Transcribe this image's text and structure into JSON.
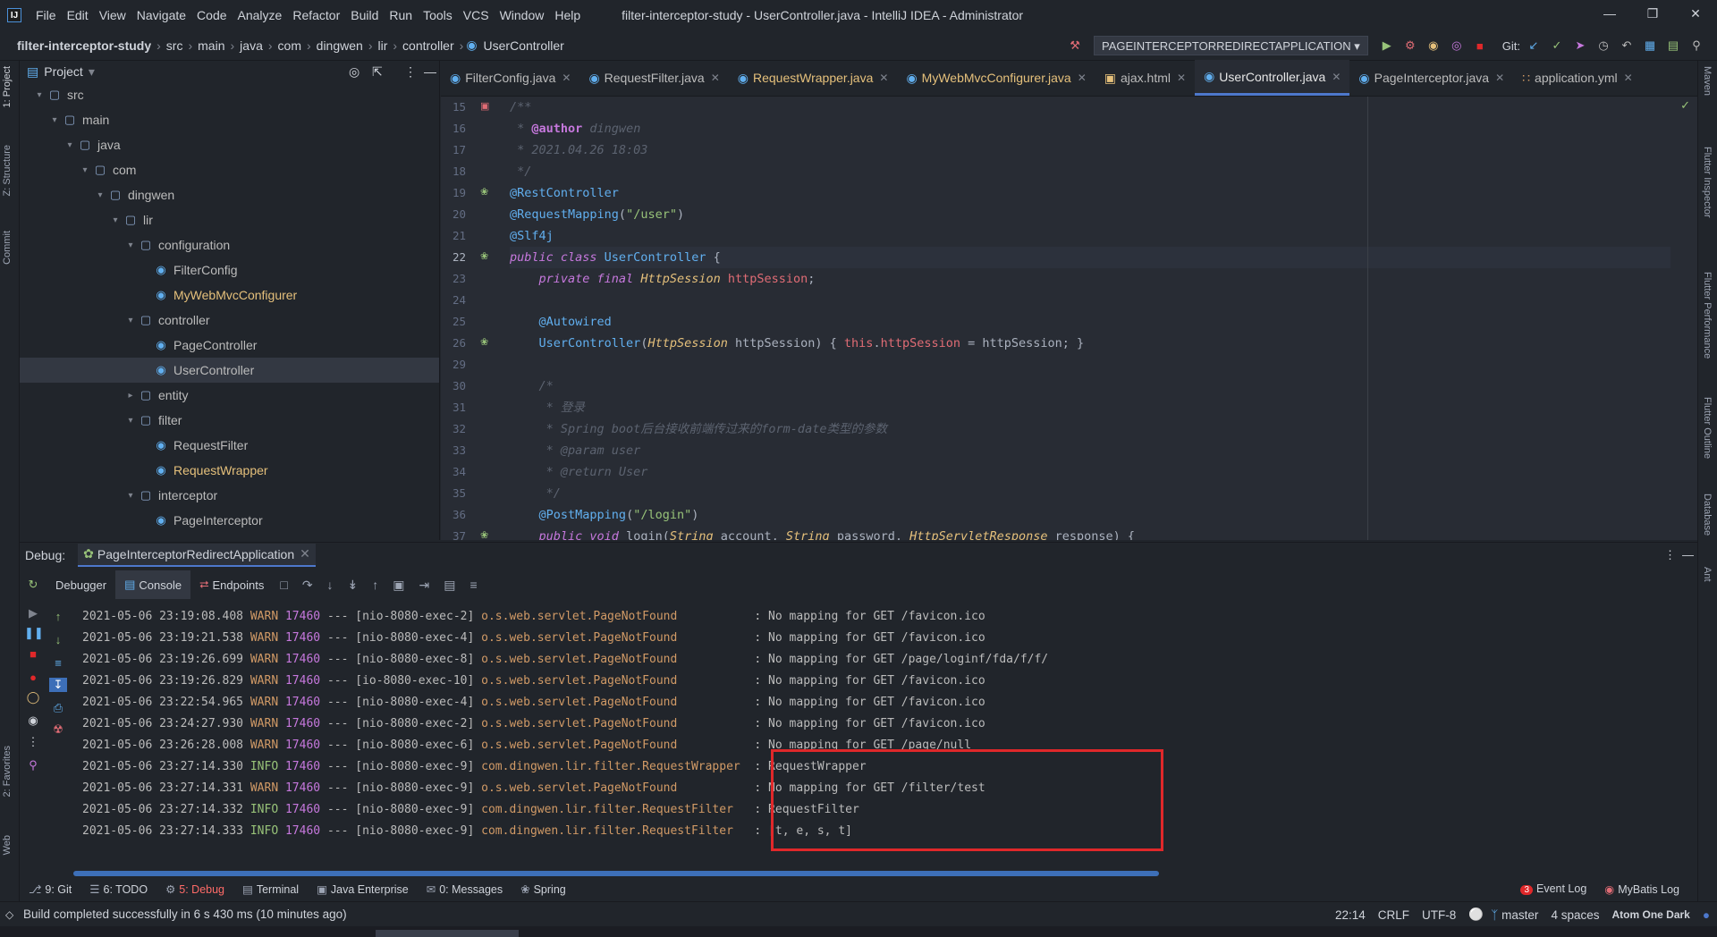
{
  "window": {
    "title": "filter-interceptor-study - UserController.java - IntelliJ IDEA - Administrator",
    "menu": [
      "File",
      "Edit",
      "View",
      "Navigate",
      "Code",
      "Analyze",
      "Refactor",
      "Build",
      "Run",
      "Tools",
      "VCS",
      "Window",
      "Help"
    ],
    "logo": "IJ"
  },
  "breadcrumb": [
    "filter-interceptor-study",
    "src",
    "main",
    "java",
    "com",
    "dingwen",
    "lir",
    "controller",
    "UserController"
  ],
  "run_config": "PAGEINTERCEPTORREDIRECTAPPLICATION",
  "git_label": "Git:",
  "project_panel": {
    "title": "Project",
    "tree": [
      {
        "label": "src",
        "depth": 0,
        "kind": "folder",
        "expanded": true
      },
      {
        "label": "main",
        "depth": 1,
        "kind": "folder",
        "expanded": true
      },
      {
        "label": "java",
        "depth": 2,
        "kind": "folder",
        "expanded": true
      },
      {
        "label": "com",
        "depth": 3,
        "kind": "folder",
        "expanded": true
      },
      {
        "label": "dingwen",
        "depth": 4,
        "kind": "folder",
        "expanded": true
      },
      {
        "label": "lir",
        "depth": 5,
        "kind": "folder",
        "expanded": true
      },
      {
        "label": "configuration",
        "depth": 6,
        "kind": "folder",
        "expanded": true
      },
      {
        "label": "FilterConfig",
        "depth": 7,
        "kind": "class"
      },
      {
        "label": "MyWebMvcConfigurer",
        "depth": 7,
        "kind": "class",
        "modified": true
      },
      {
        "label": "controller",
        "depth": 6,
        "kind": "folder",
        "expanded": true
      },
      {
        "label": "PageController",
        "depth": 7,
        "kind": "class"
      },
      {
        "label": "UserController",
        "depth": 7,
        "kind": "class",
        "selected": true
      },
      {
        "label": "entity",
        "depth": 6,
        "kind": "folder",
        "expanded": false
      },
      {
        "label": "filter",
        "depth": 6,
        "kind": "folder",
        "expanded": true
      },
      {
        "label": "RequestFilter",
        "depth": 7,
        "kind": "class"
      },
      {
        "label": "RequestWrapper",
        "depth": 7,
        "kind": "class",
        "modified": true
      },
      {
        "label": "interceptor",
        "depth": 6,
        "kind": "folder",
        "expanded": true
      },
      {
        "label": "PageInterceptor",
        "depth": 7,
        "kind": "class"
      }
    ]
  },
  "editor_tabs": [
    {
      "label": "FilterConfig.java",
      "icon": "class",
      "active": false
    },
    {
      "label": "RequestFilter.java",
      "icon": "class",
      "active": false
    },
    {
      "label": "RequestWrapper.java",
      "icon": "class",
      "active": false,
      "modified": true
    },
    {
      "label": "MyWebMvcConfigurer.java",
      "icon": "class",
      "active": false,
      "modified": true
    },
    {
      "label": "ajax.html",
      "icon": "html",
      "active": false
    },
    {
      "label": "UserController.java",
      "icon": "class",
      "active": true
    },
    {
      "label": "PageInterceptor.java",
      "icon": "class",
      "active": false
    },
    {
      "label": "application.yml",
      "icon": "yml",
      "active": false
    }
  ],
  "code_lines": [
    {
      "n": "15",
      "segs": [
        [
          "c-com",
          "/**"
        ]
      ]
    },
    {
      "n": "16",
      "segs": [
        [
          "c-com",
          " * "
        ],
        [
          "c-tag",
          "@author"
        ],
        [
          "c-com",
          " dingwen"
        ]
      ]
    },
    {
      "n": "17",
      "segs": [
        [
          "c-com",
          " * 2021.04.26 18:03"
        ]
      ]
    },
    {
      "n": "18",
      "segs": [
        [
          "c-com",
          " */"
        ]
      ]
    },
    {
      "n": "19",
      "segs": [
        [
          "c-ann",
          "@RestController"
        ]
      ]
    },
    {
      "n": "20",
      "segs": [
        [
          "c-ann",
          "@RequestMapping"
        ],
        [
          "c-plain",
          "("
        ],
        [
          "c-str",
          "\"/user\""
        ],
        [
          "c-plain",
          ")"
        ]
      ]
    },
    {
      "n": "21",
      "segs": [
        [
          "c-ann",
          "@Slf4j"
        ]
      ]
    },
    {
      "n": "22",
      "segs": [
        [
          "c-kw",
          "public class "
        ],
        [
          "c-cls",
          "UserController"
        ],
        [
          "c-plain",
          " {"
        ]
      ],
      "current": true
    },
    {
      "n": "23",
      "segs": [
        [
          "c-plain",
          "    "
        ],
        [
          "c-kw",
          "private final "
        ],
        [
          "c-type",
          "HttpSession "
        ],
        [
          "c-fld",
          "httpSession"
        ],
        [
          "c-plain",
          ";"
        ]
      ]
    },
    {
      "n": "24",
      "segs": []
    },
    {
      "n": "25",
      "segs": [
        [
          "c-plain",
          "    "
        ],
        [
          "c-ann",
          "@Autowired"
        ]
      ]
    },
    {
      "n": "26",
      "segs": [
        [
          "c-plain",
          "    "
        ],
        [
          "c-cls",
          "UserController"
        ],
        [
          "c-plain",
          "("
        ],
        [
          "c-type",
          "HttpSession "
        ],
        [
          "c-plain",
          "httpSession) { "
        ],
        [
          "c-fld",
          "this"
        ],
        [
          "c-plain",
          "."
        ],
        [
          "c-fld",
          "httpSession"
        ],
        [
          "c-plain",
          " = httpSession; }"
        ]
      ]
    },
    {
      "n": "29",
      "segs": []
    },
    {
      "n": "30",
      "segs": [
        [
          "c-plain",
          "    "
        ],
        [
          "c-com",
          "/*"
        ]
      ]
    },
    {
      "n": "31",
      "segs": [
        [
          "c-com",
          "     * 登录"
        ]
      ]
    },
    {
      "n": "32",
      "segs": [
        [
          "c-com",
          "     * Spring boot后台接收前端传过来的form-date类型的参数"
        ]
      ]
    },
    {
      "n": "33",
      "segs": [
        [
          "c-com",
          "     * @param user"
        ]
      ]
    },
    {
      "n": "34",
      "segs": [
        [
          "c-com",
          "     * @return User"
        ]
      ]
    },
    {
      "n": "35",
      "segs": [
        [
          "c-com",
          "     */"
        ]
      ]
    },
    {
      "n": "36",
      "segs": [
        [
          "c-plain",
          "    "
        ],
        [
          "c-ann",
          "@PostMapping"
        ],
        [
          "c-plain",
          "("
        ],
        [
          "c-str",
          "\"/login\""
        ],
        [
          "c-plain",
          ")"
        ]
      ]
    },
    {
      "n": "37",
      "segs": [
        [
          "c-plain",
          "    "
        ],
        [
          "c-kw",
          "public void "
        ],
        [
          "c-plain",
          "login("
        ],
        [
          "c-type",
          "String "
        ],
        [
          "c-plain",
          "account, "
        ],
        [
          "c-type",
          "String "
        ],
        [
          "c-plain",
          "password, "
        ],
        [
          "c-type",
          "HttpServletResponse "
        ],
        [
          "c-plain",
          "response) {"
        ]
      ]
    }
  ],
  "debug": {
    "label": "Debug:",
    "session": "PageInterceptorRedirectApplication",
    "tabs": [
      "Debugger",
      "Console",
      "Endpoints"
    ]
  },
  "console_lines": [
    {
      "ts": "2021-05-06 23:19:08.408",
      "level": "WARN",
      "pid": "17460",
      "thread": "--- [nio-8080-exec-2]",
      "logger": "o.s.web.servlet.PageNotFound          ",
      "msg": ": No mapping for GET /favicon.ico"
    },
    {
      "ts": "2021-05-06 23:19:21.538",
      "level": "WARN",
      "pid": "17460",
      "thread": "--- [nio-8080-exec-4]",
      "logger": "o.s.web.servlet.PageNotFound          ",
      "msg": ": No mapping for GET /favicon.ico"
    },
    {
      "ts": "2021-05-06 23:19:26.699",
      "level": "WARN",
      "pid": "17460",
      "thread": "--- [nio-8080-exec-8]",
      "logger": "o.s.web.servlet.PageNotFound          ",
      "msg": ": No mapping for GET /page/loginf/fda/f/f/"
    },
    {
      "ts": "2021-05-06 23:19:26.829",
      "level": "WARN",
      "pid": "17460",
      "thread": "--- [io-8080-exec-10]",
      "logger": "o.s.web.servlet.PageNotFound          ",
      "msg": ": No mapping for GET /favicon.ico"
    },
    {
      "ts": "2021-05-06 23:22:54.965",
      "level": "WARN",
      "pid": "17460",
      "thread": "--- [nio-8080-exec-4]",
      "logger": "o.s.web.servlet.PageNotFound          ",
      "msg": ": No mapping for GET /favicon.ico"
    },
    {
      "ts": "2021-05-06 23:24:27.930",
      "level": "WARN",
      "pid": "17460",
      "thread": "--- [nio-8080-exec-2]",
      "logger": "o.s.web.servlet.PageNotFound          ",
      "msg": ": No mapping for GET /favicon.ico"
    },
    {
      "ts": "2021-05-06 23:26:28.008",
      "level": "WARN",
      "pid": "17460",
      "thread": "--- [nio-8080-exec-6]",
      "logger": "o.s.web.servlet.PageNotFound          ",
      "msg": ": No mapping for GET /page/null"
    },
    {
      "ts": "2021-05-06 23:27:14.330",
      "level": "INFO",
      "pid": "17460",
      "thread": "--- [nio-8080-exec-9]",
      "logger": "com.dingwen.lir.filter.RequestWrapper ",
      "msg": ": RequestWrapper"
    },
    {
      "ts": "2021-05-06 23:27:14.331",
      "level": "WARN",
      "pid": "17460",
      "thread": "--- [nio-8080-exec-9]",
      "logger": "o.s.web.servlet.PageNotFound          ",
      "msg": ": No mapping for GET /filter/test"
    },
    {
      "ts": "2021-05-06 23:27:14.332",
      "level": "INFO",
      "pid": "17460",
      "thread": "--- [nio-8080-exec-9]",
      "logger": "com.dingwen.lir.filter.RequestFilter  ",
      "msg": ": RequestFilter"
    },
    {
      "ts": "2021-05-06 23:27:14.333",
      "level": "INFO",
      "pid": "17460",
      "thread": "--- [nio-8080-exec-9]",
      "logger": "com.dingwen.lir.filter.RequestFilter  ",
      "msg": ": [t, e, s, t]"
    }
  ],
  "bottom_tabs": [
    {
      "label": "9: Git",
      "icon": "git-icon"
    },
    {
      "label": "6: TODO",
      "icon": "todo-icon"
    },
    {
      "label": "5: Debug",
      "icon": "debug-icon",
      "active": true
    },
    {
      "label": "Terminal",
      "icon": "terminal-icon"
    },
    {
      "label": "Java Enterprise",
      "icon": "java-enterprise-icon"
    },
    {
      "label": "0: Messages",
      "icon": "messages-icon"
    },
    {
      "label": "Spring",
      "icon": "spring-icon"
    }
  ],
  "bottom_right_tabs": [
    {
      "label": "Event Log",
      "badge": "3"
    },
    {
      "label": "MyBatis Log"
    }
  ],
  "status": {
    "message": "Build completed successfully in 6 s 430 ms (10 minutes ago)",
    "position": "22:14",
    "line_sep": "CRLF",
    "encoding": "UTF-8",
    "branch": "master",
    "indent": "4 spaces",
    "theme": "Atom One Dark"
  },
  "left_strip": [
    "1: Project",
    "Z: Structure",
    "Commit",
    "2: Favorites",
    "Web"
  ],
  "right_strip": [
    "Maven",
    "Flutter Inspector",
    "Flutter Performance",
    "Flutter Outline",
    "Database",
    "Ant"
  ],
  "colors": {
    "accent": "#4d78cc",
    "highlight_box": "#e0282a",
    "warn": "#d19a66",
    "info": "#98c379"
  }
}
